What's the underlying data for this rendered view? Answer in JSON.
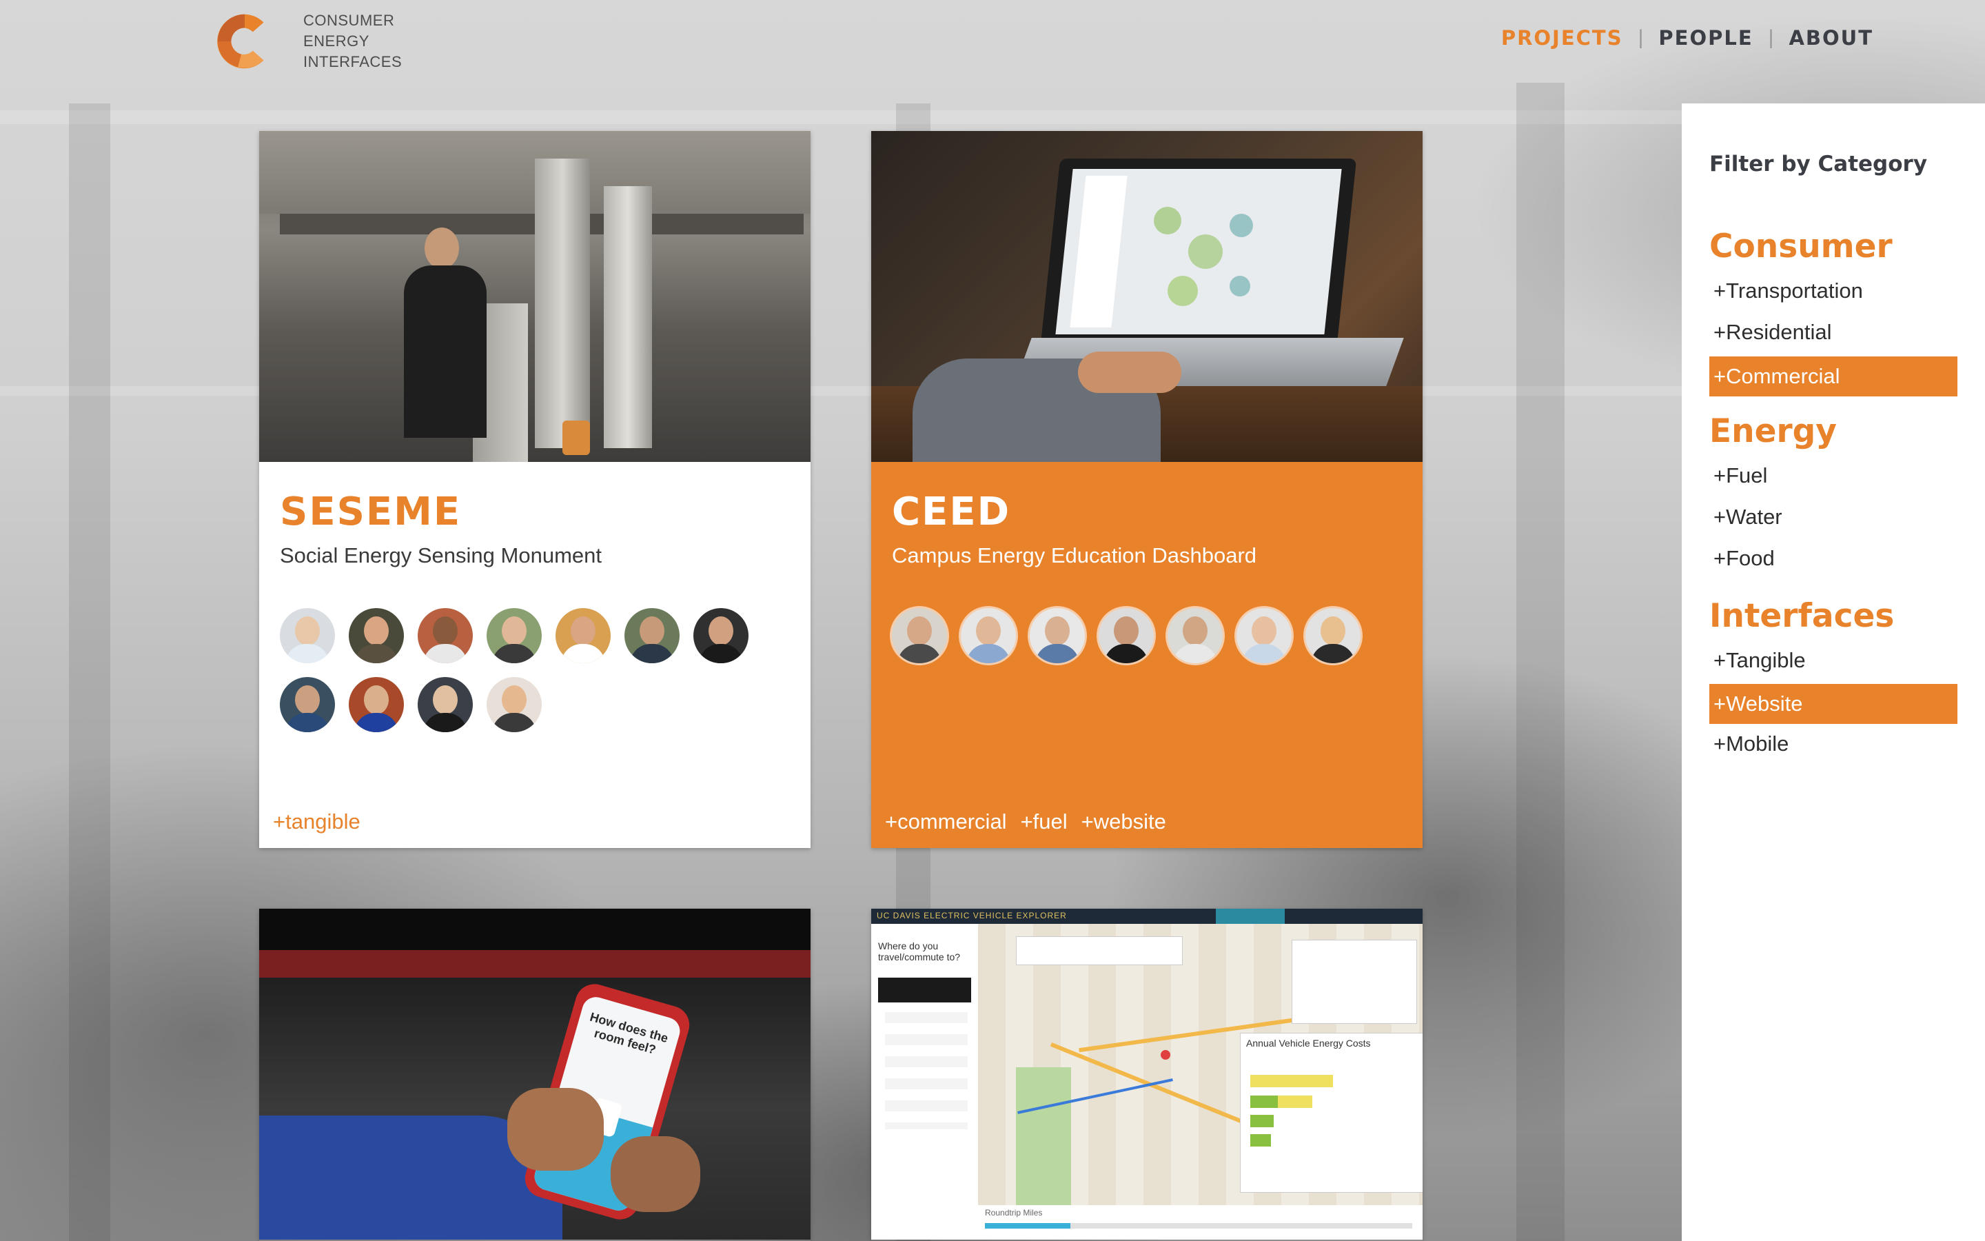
{
  "brand": {
    "line1": "CONSUMER",
    "line2": "ENERGY",
    "line3": "INTERFACES",
    "color": "#e8822b"
  },
  "nav": {
    "items": [
      "PROJECTS",
      "PEOPLE",
      "ABOUT"
    ],
    "separator": "|",
    "active": "PROJECTS"
  },
  "projects": [
    {
      "title": "SESEME",
      "subtitle": "Social Energy Sensing Monument",
      "image": "workshop-photo",
      "style": "white",
      "tags": [
        "+tangible"
      ],
      "avatar_count": 11
    },
    {
      "title": "CEED",
      "subtitle": "Campus Energy Education Dashboard",
      "image": "laptop-photo",
      "style": "orange",
      "tags": [
        "+commercial",
        "+fuel",
        "+website"
      ],
      "avatar_count": 7
    },
    {
      "image": "phone-app-photo",
      "phone_screen_text": "How does the room feel?"
    },
    {
      "image": "ev-explorer-screenshot",
      "screen_title": "UC DAVIS ELECTRIC VEHICLE EXPLORER",
      "screen_step": "Where do you travel/commute to?",
      "screen_panel": "Annual Vehicle Energy Costs",
      "screen_footer": "Roundtrip Miles"
    }
  ],
  "sidebar": {
    "heading": "Filter by Category",
    "groups": [
      {
        "name": "Consumer",
        "options": [
          {
            "label": "+Transportation",
            "selected": false
          },
          {
            "label": "+Residential",
            "selected": false
          },
          {
            "label": "+Commercial",
            "selected": true
          }
        ]
      },
      {
        "name": "Energy",
        "options": [
          {
            "label": "+Fuel",
            "selected": false
          },
          {
            "label": "+Water",
            "selected": false
          },
          {
            "label": "+Food",
            "selected": false
          }
        ]
      },
      {
        "name": "Interfaces",
        "options": [
          {
            "label": "+Tangible",
            "selected": false
          },
          {
            "label": "+Website",
            "selected": true
          },
          {
            "label": "+Mobile",
            "selected": false
          }
        ]
      }
    ]
  },
  "colors": {
    "accent": "#e8822b",
    "text_dark": "#3b3f45"
  }
}
